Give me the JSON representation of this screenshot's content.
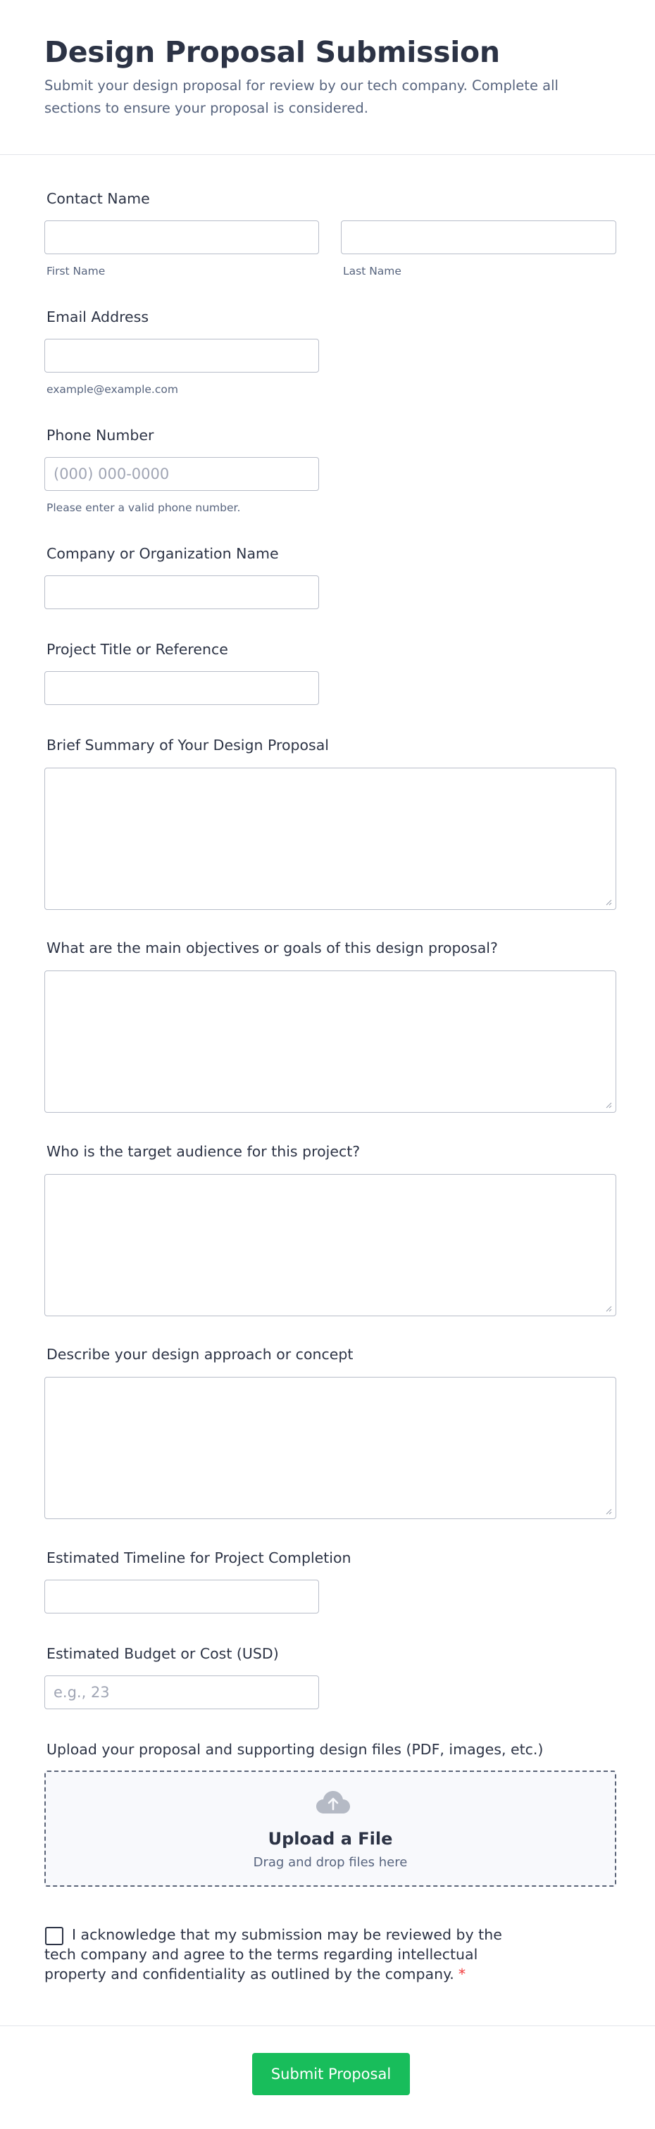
{
  "header": {
    "title": "Design Proposal Submission",
    "subtitle": "Submit your design proposal for review by our tech company. Complete all sections to ensure your proposal is considered."
  },
  "fields": {
    "contact_name": {
      "label": "Contact Name",
      "first_sublabel": "First Name",
      "last_sublabel": "Last Name",
      "first_value": "",
      "last_value": ""
    },
    "email": {
      "label": "Email Address",
      "sublabel": "example@example.com",
      "value": ""
    },
    "phone": {
      "label": "Phone Number",
      "placeholder": "(000) 000-0000",
      "sublabel": "Please enter a valid phone number.",
      "value": ""
    },
    "company": {
      "label": "Company or Organization Name",
      "value": ""
    },
    "project_title": {
      "label": "Project Title or Reference",
      "value": ""
    },
    "summary": {
      "label": "Brief Summary of Your Design Proposal"
    },
    "objectives": {
      "label": "What are the main objectives or goals of this design proposal?"
    },
    "audience": {
      "label": "Who is the target audience for this project?"
    },
    "approach": {
      "label": "Describe your design approach or concept"
    },
    "timeline": {
      "label": "Estimated Timeline for Project Completion",
      "value": ""
    },
    "budget": {
      "label": "Estimated Budget or Cost (USD)",
      "placeholder": "e.g., 23",
      "value": ""
    },
    "upload": {
      "label": "Upload your proposal and supporting design files (PDF, images, etc.)",
      "title": "Upload a File",
      "subtitle": "Drag and drop files here",
      "icon": "cloud-upload-icon"
    },
    "acknowledge": {
      "text": "I acknowledge that my submission may be reviewed by the tech company and agree to the terms regarding intellectual property and confidentiality as outlined by the company.",
      "required_mark": "*",
      "checked": false
    }
  },
  "submit": {
    "label": "Submit Proposal"
  },
  "colors": {
    "text": "#2c3345",
    "muted": "#57647e",
    "border": "#b8bdc9",
    "submit": "#18bd5b",
    "required": "#f23a3c"
  }
}
